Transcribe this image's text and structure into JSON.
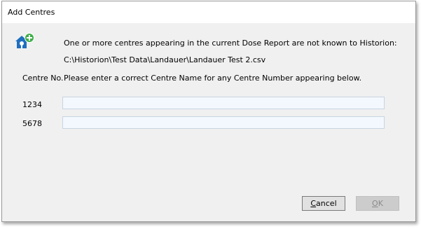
{
  "window": {
    "title": "Add Centres"
  },
  "icon": "add-home-icon",
  "message": {
    "line1": "One or more centres appearing in the current Dose Report are not known to Historion:",
    "file_path": "C:\\Historion\\Test Data\\Landauer\\Landauer Test 2.csv"
  },
  "table": {
    "header_label": "Centre No.",
    "instruction": "Please enter a correct Centre Name for any Centre Number appearing below.",
    "rows": [
      {
        "number": "1234",
        "name_value": ""
      },
      {
        "number": "5678",
        "name_value": ""
      }
    ]
  },
  "buttons": {
    "cancel_mnemonic": "C",
    "cancel_rest": "ancel",
    "ok_mnemonic": "O",
    "ok_rest": "K",
    "ok_enabled": false
  },
  "colors": {
    "dialog_bg": "#f0f0f0",
    "input_bg": "#f2f8fe",
    "icon_blue": "#1e6fbf",
    "icon_green": "#3fae49"
  }
}
